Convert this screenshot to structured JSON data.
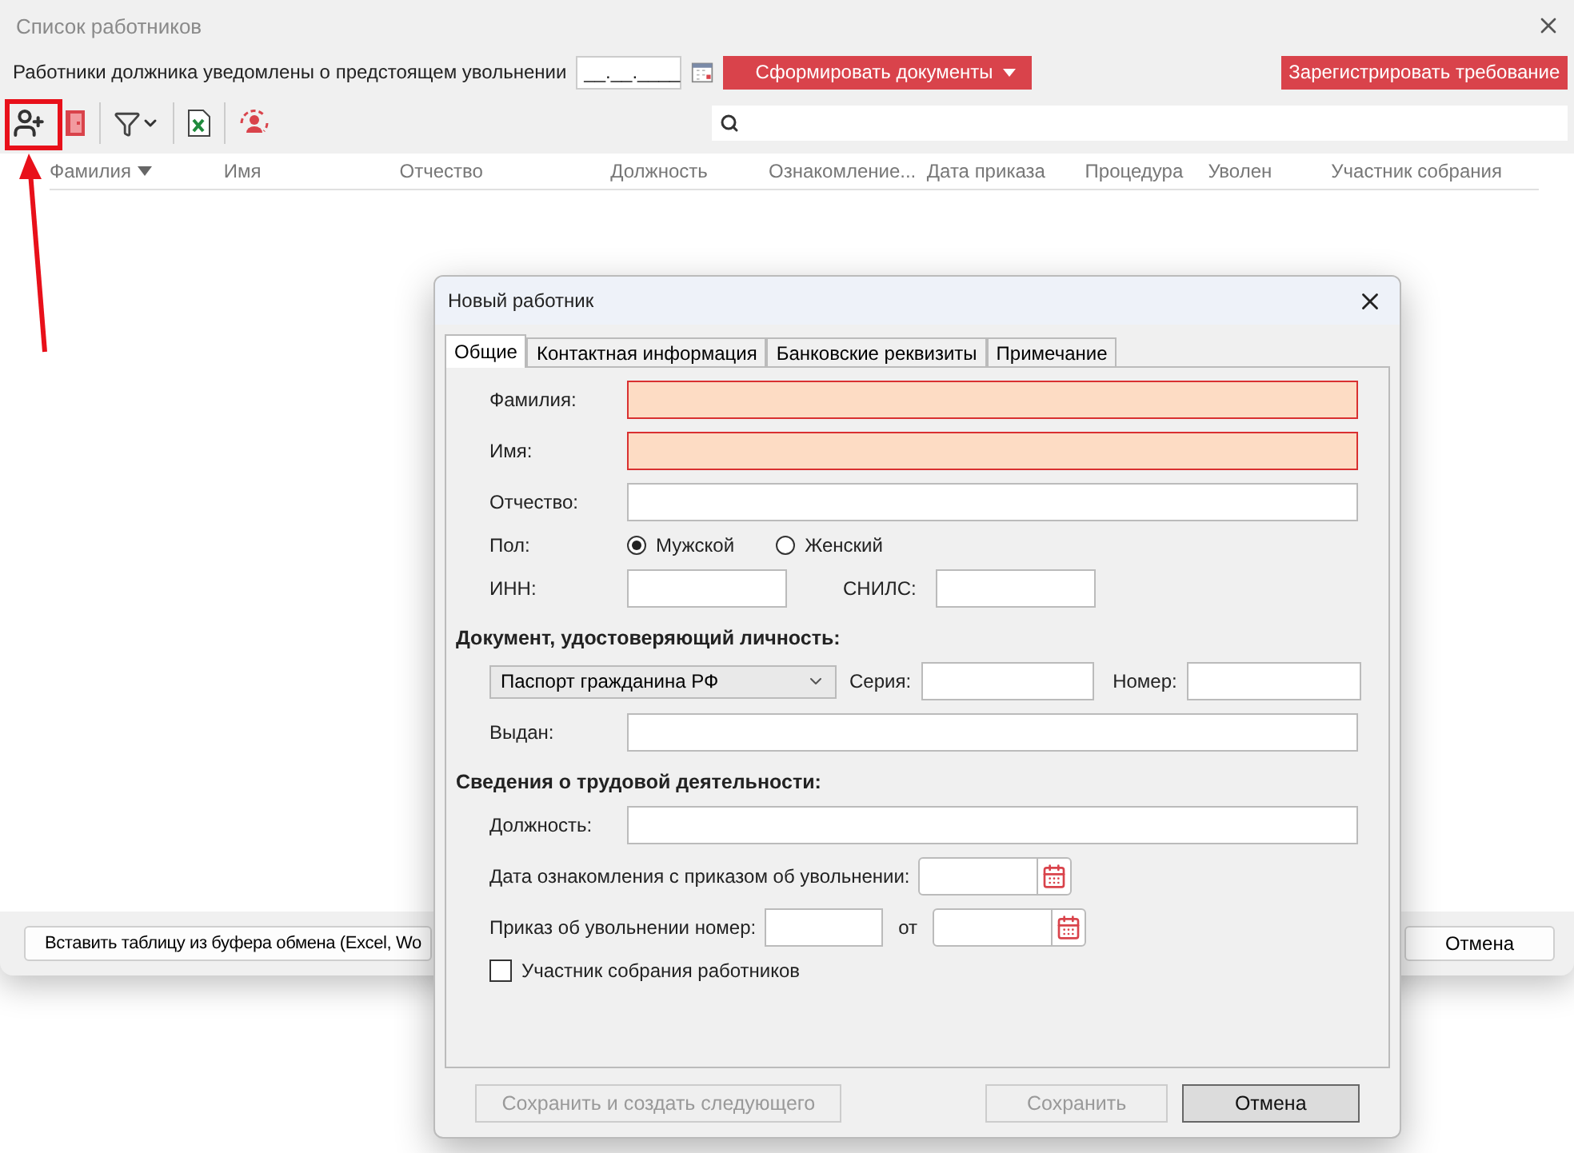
{
  "window": {
    "title": "Список работников"
  },
  "notice": {
    "label": "Работники должника уведомлены о предстоящем увольнении",
    "date_value": "__.__.____"
  },
  "actions": {
    "generate": "Сформировать документы",
    "register": "Зарегистрировать требование"
  },
  "table": {
    "columns": [
      {
        "label": "Фамилия",
        "sorted": true
      },
      {
        "label": "Имя",
        "sorted": false
      },
      {
        "label": "Отчество",
        "sorted": false
      },
      {
        "label": "Должность",
        "sorted": false
      },
      {
        "label": "Ознакомление...",
        "sorted": false
      },
      {
        "label": "Дата приказа",
        "sorted": false
      },
      {
        "label": "Процедура",
        "sorted": false
      },
      {
        "label": "Уволен",
        "sorted": false
      },
      {
        "label": "Участник собрания",
        "sorted": false
      }
    ]
  },
  "bottom": {
    "paste": "Вставить таблицу из буфера обмена (Excel, Wo",
    "cancel": "Отмена"
  },
  "dialog": {
    "title": "Новый работник",
    "tabs": [
      {
        "label": "Общие",
        "selected": true
      },
      {
        "label": "Контактная информация",
        "selected": false
      },
      {
        "label": "Банковские реквизиты",
        "selected": false
      },
      {
        "label": "Примечание",
        "selected": false
      }
    ],
    "surname": {
      "label": "Фамилия:",
      "invalid": true
    },
    "name": {
      "label": "Имя:",
      "invalid": true
    },
    "patronymic": {
      "label": "Отчество:",
      "invalid": false
    },
    "gender": {
      "label": "Пол:",
      "options": [
        {
          "label": "Мужской",
          "selected": true
        },
        {
          "label": "Женский",
          "selected": false
        }
      ]
    },
    "inn": {
      "label": "ИНН:"
    },
    "snils": {
      "label": "СНИЛС:"
    },
    "document_heading": "Документ, удостоверяющий личность:",
    "document_type": "Паспорт гражданина РФ",
    "series": {
      "label": "Серия:"
    },
    "number": {
      "label": "Номер:"
    },
    "issued": {
      "label": "Выдан:"
    },
    "work_heading": "Сведения о трудовой деятельности:",
    "position": {
      "label": "Должность:"
    },
    "ack_date": {
      "label": "Дата ознакомления с приказом об увольнении:"
    },
    "order": {
      "label": "Приказ об увольнении номер:",
      "from": "от"
    },
    "participant": {
      "label": "Участник собрания работников",
      "checked": false
    },
    "buttons": [
      {
        "label": "Сохранить и создать следующего",
        "disabled": true,
        "default": false
      },
      {
        "label": "Сохранить",
        "disabled": true,
        "default": false
      },
      {
        "label": "Отмена",
        "disabled": false,
        "default": true
      }
    ]
  }
}
